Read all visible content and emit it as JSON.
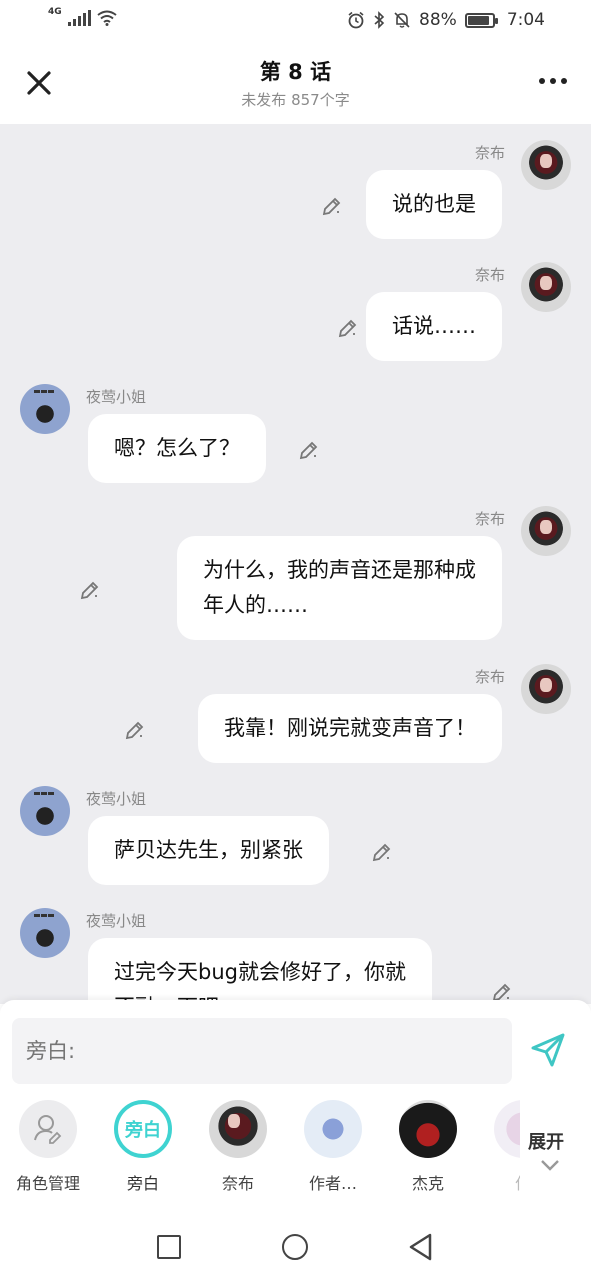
{
  "status_bar": {
    "network": "4G",
    "battery_percent": "88%",
    "battery_level": 0.88,
    "time": "7:04",
    "icons": [
      "signal-icon",
      "wifi-icon",
      "alarm-icon",
      "bluetooth-icon",
      "mute-icon",
      "battery-icon"
    ]
  },
  "header": {
    "title": "第 8 话",
    "subtitle": "未发布 857个字"
  },
  "messages": [
    {
      "side": "right",
      "speaker": "奈布",
      "text": "说的也是"
    },
    {
      "side": "right",
      "speaker": "奈布",
      "text": "话说……"
    },
    {
      "side": "left",
      "speaker": "夜莺小姐",
      "text": "嗯？怎么了？"
    },
    {
      "side": "right",
      "speaker": "奈布",
      "text": "为什么，我的声音还是那种成\n年人的……"
    },
    {
      "side": "right",
      "speaker": "奈布",
      "text": "我靠！刚说完就变声音了！"
    },
    {
      "side": "left",
      "speaker": "夜莺小姐",
      "text": "萨贝达先生，别紧张"
    },
    {
      "side": "left",
      "speaker": "夜莺小姐",
      "text": "过完今天bug就会修好了，你就\n不融一下吧"
    }
  ],
  "composer": {
    "placeholder": "旁白:"
  },
  "roles": [
    {
      "label": "角色管理",
      "icon": "role-manage-icon"
    },
    {
      "label": "旁白",
      "badge": "旁白"
    },
    {
      "label": "奈布",
      "icon": "avatar"
    },
    {
      "label": "作者…",
      "icon": "avatar"
    },
    {
      "label": "杰克",
      "icon": "avatar"
    },
    {
      "label": "作",
      "icon": "avatar"
    }
  ],
  "expand_label": "展开",
  "colors": {
    "accent": "#3fd3d1",
    "chat_bg": "#ededf0",
    "send": "#3fc6c4"
  }
}
